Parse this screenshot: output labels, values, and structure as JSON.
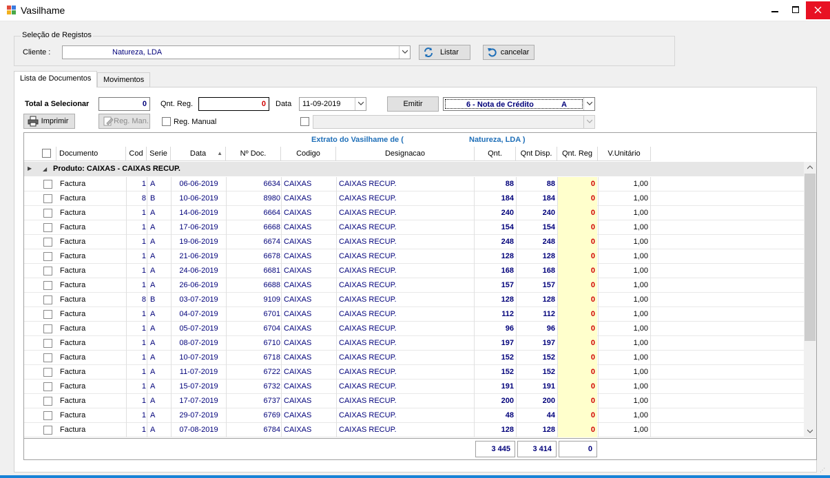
{
  "window": {
    "title": "Vasilhame",
    "min_label": "🗕",
    "max_label": "🗖",
    "close_label": "✕"
  },
  "selection": {
    "group_title": "Seleção de Registos",
    "cliente_label": "Cliente :",
    "cliente_value": "Natureza, LDA",
    "listar_label": "Listar",
    "cancelar_label": "cancelar"
  },
  "tabs": [
    {
      "label": "Lista de Documentos"
    },
    {
      "label": "Movimentos"
    }
  ],
  "toolbar": {
    "total_label": "Total a Selecionar",
    "total_value": "0",
    "qnt_reg_label": "Qnt. Reg.",
    "qnt_reg_value": "0",
    "data_label": "Data",
    "data_value": "11-09-2019",
    "emitir_label": "Emitir",
    "doc_type_value": "6 - Nota de Crédito",
    "doc_type_serie": "A",
    "imprimir_label": "Imprimir",
    "reg_man_label": "Reg. Man.",
    "reg_manual_label": "Reg. Manual"
  },
  "grid": {
    "caption_left": "Extrato do Vasilhame de (",
    "caption_right": "Natureza, LDA )",
    "columns": [
      "Documento",
      "Cod",
      "Serie",
      "Data",
      "Nº Doc.",
      "Codigo",
      "Designacao",
      "Qnt.",
      "Qnt Disp.",
      "Qnt. Reg",
      "V.Unitário"
    ],
    "sort_icon": "▲",
    "group_label": "Produto: CAIXAS - CAIXAS RECUP.",
    "rows": [
      {
        "doc": "Factura",
        "cod": "1",
        "serie": "A",
        "data": "06-06-2019",
        "ndoc": "6634",
        "codigo": "CAIXAS",
        "desig": "CAIXAS RECUP.",
        "qnt": "88",
        "disp": "88",
        "reg": "0",
        "vu": "1,00"
      },
      {
        "doc": "Factura",
        "cod": "8",
        "serie": "B",
        "data": "10-06-2019",
        "ndoc": "8980",
        "codigo": "CAIXAS",
        "desig": "CAIXAS RECUP.",
        "qnt": "184",
        "disp": "184",
        "reg": "0",
        "vu": "1,00"
      },
      {
        "doc": "Factura",
        "cod": "1",
        "serie": "A",
        "data": "14-06-2019",
        "ndoc": "6664",
        "codigo": "CAIXAS",
        "desig": "CAIXAS RECUP.",
        "qnt": "240",
        "disp": "240",
        "reg": "0",
        "vu": "1,00"
      },
      {
        "doc": "Factura",
        "cod": "1",
        "serie": "A",
        "data": "17-06-2019",
        "ndoc": "6668",
        "codigo": "CAIXAS",
        "desig": "CAIXAS RECUP.",
        "qnt": "154",
        "disp": "154",
        "reg": "0",
        "vu": "1,00"
      },
      {
        "doc": "Factura",
        "cod": "1",
        "serie": "A",
        "data": "19-06-2019",
        "ndoc": "6674",
        "codigo": "CAIXAS",
        "desig": "CAIXAS RECUP.",
        "qnt": "248",
        "disp": "248",
        "reg": "0",
        "vu": "1,00"
      },
      {
        "doc": "Factura",
        "cod": "1",
        "serie": "A",
        "data": "21-06-2019",
        "ndoc": "6678",
        "codigo": "CAIXAS",
        "desig": "CAIXAS RECUP.",
        "qnt": "128",
        "disp": "128",
        "reg": "0",
        "vu": "1,00"
      },
      {
        "doc": "Factura",
        "cod": "1",
        "serie": "A",
        "data": "24-06-2019",
        "ndoc": "6681",
        "codigo": "CAIXAS",
        "desig": "CAIXAS RECUP.",
        "qnt": "168",
        "disp": "168",
        "reg": "0",
        "vu": "1,00"
      },
      {
        "doc": "Factura",
        "cod": "1",
        "serie": "A",
        "data": "26-06-2019",
        "ndoc": "6688",
        "codigo": "CAIXAS",
        "desig": "CAIXAS RECUP.",
        "qnt": "157",
        "disp": "157",
        "reg": "0",
        "vu": "1,00"
      },
      {
        "doc": "Factura",
        "cod": "8",
        "serie": "B",
        "data": "03-07-2019",
        "ndoc": "9109",
        "codigo": "CAIXAS",
        "desig": "CAIXAS RECUP.",
        "qnt": "128",
        "disp": "128",
        "reg": "0",
        "vu": "1,00"
      },
      {
        "doc": "Factura",
        "cod": "1",
        "serie": "A",
        "data": "04-07-2019",
        "ndoc": "6701",
        "codigo": "CAIXAS",
        "desig": "CAIXAS RECUP.",
        "qnt": "112",
        "disp": "112",
        "reg": "0",
        "vu": "1,00"
      },
      {
        "doc": "Factura",
        "cod": "1",
        "serie": "A",
        "data": "05-07-2019",
        "ndoc": "6704",
        "codigo": "CAIXAS",
        "desig": "CAIXAS RECUP.",
        "qnt": "96",
        "disp": "96",
        "reg": "0",
        "vu": "1,00"
      },
      {
        "doc": "Factura",
        "cod": "1",
        "serie": "A",
        "data": "08-07-2019",
        "ndoc": "6710",
        "codigo": "CAIXAS",
        "desig": "CAIXAS RECUP.",
        "qnt": "197",
        "disp": "197",
        "reg": "0",
        "vu": "1,00"
      },
      {
        "doc": "Factura",
        "cod": "1",
        "serie": "A",
        "data": "10-07-2019",
        "ndoc": "6718",
        "codigo": "CAIXAS",
        "desig": "CAIXAS RECUP.",
        "qnt": "152",
        "disp": "152",
        "reg": "0",
        "vu": "1,00"
      },
      {
        "doc": "Factura",
        "cod": "1",
        "serie": "A",
        "data": "11-07-2019",
        "ndoc": "6722",
        "codigo": "CAIXAS",
        "desig": "CAIXAS RECUP.",
        "qnt": "152",
        "disp": "152",
        "reg": "0",
        "vu": "1,00"
      },
      {
        "doc": "Factura",
        "cod": "1",
        "serie": "A",
        "data": "15-07-2019",
        "ndoc": "6732",
        "codigo": "CAIXAS",
        "desig": "CAIXAS RECUP.",
        "qnt": "191",
        "disp": "191",
        "reg": "0",
        "vu": "1,00"
      },
      {
        "doc": "Factura",
        "cod": "1",
        "serie": "A",
        "data": "17-07-2019",
        "ndoc": "6737",
        "codigo": "CAIXAS",
        "desig": "CAIXAS RECUP.",
        "qnt": "200",
        "disp": "200",
        "reg": "0",
        "vu": "1,00"
      },
      {
        "doc": "Factura",
        "cod": "1",
        "serie": "A",
        "data": "29-07-2019",
        "ndoc": "6769",
        "codigo": "CAIXAS",
        "desig": "CAIXAS RECUP.",
        "qnt": "48",
        "disp": "44",
        "reg": "0",
        "vu": "1,00"
      },
      {
        "doc": "Factura",
        "cod": "1",
        "serie": "A",
        "data": "07-08-2019",
        "ndoc": "6784",
        "codigo": "CAIXAS",
        "desig": "CAIXAS RECUP.",
        "qnt": "128",
        "disp": "128",
        "reg": "0",
        "vu": "1,00"
      }
    ],
    "totals": {
      "qnt": "3 445",
      "disp": "3 414",
      "reg": "0"
    }
  },
  "colors": {
    "accent": "#1f6fb8",
    "value_blue": "#00007a",
    "reg_red": "#d00000",
    "reg_bg": "#ffffcc",
    "close_red": "#e81123"
  }
}
